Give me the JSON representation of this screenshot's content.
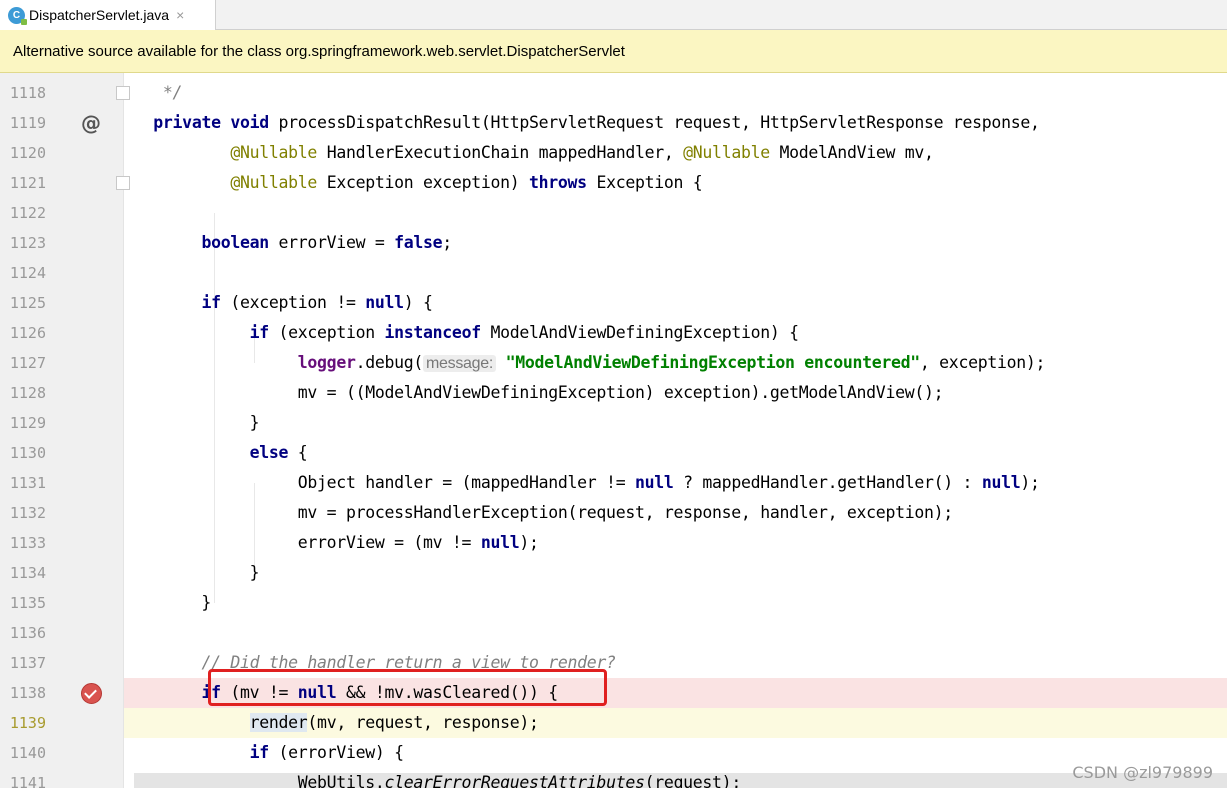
{
  "tab": {
    "file_name": "DispatcherServlet.java",
    "icon": "java-class-icon",
    "close_glyph": "×"
  },
  "banner": {
    "message": "Alternative source available for the class org.springframework.web.servlet.DispatcherServlet"
  },
  "editor": {
    "line_numbers": [
      "1118",
      "1119",
      "1120",
      "1121",
      "1122",
      "1123",
      "1124",
      "1125",
      "1126",
      "1127",
      "1128",
      "1129",
      "1130",
      "1131",
      "1132",
      "1133",
      "1134",
      "1135",
      "1136",
      "1137",
      "1138",
      "1139",
      "1140",
      "1141"
    ],
    "comment_end": "*/",
    "param_hint": "message:",
    "debug_string": "\"ModelAndViewDefiningException encountered\"",
    "comment_render": "// Did the handler return a view to render?"
  },
  "watermark": "CSDN @zl979899",
  "colors": {
    "keyword": "#000080",
    "annotation": "#808000",
    "string": "#008000",
    "breakpoint_line": "#fae3e3",
    "caret_line": "#fcfae0",
    "highlight_box": "#e02020",
    "banner_bg": "#fbf6c2"
  }
}
